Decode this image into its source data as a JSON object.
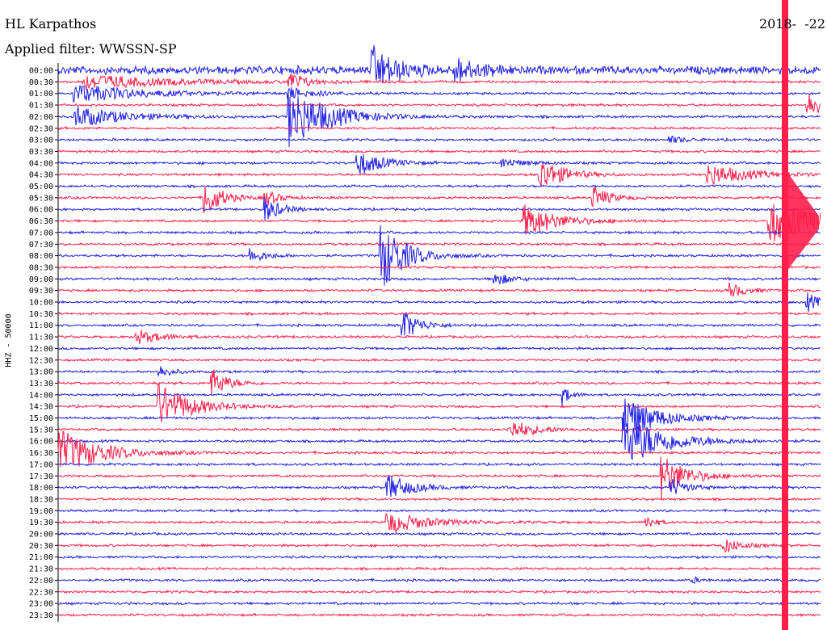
{
  "header": {
    "station": "HL Karpathos",
    "date": "2018-  -22",
    "filter": "Applied filter: WWSSN-SP"
  },
  "colors": {
    "even": "#1f1fe6",
    "odd": "#ff1f4b",
    "background": "#ffffff"
  },
  "chart_data": {
    "type": "line",
    "title": "HL Karpathos",
    "ylabel": "HHZ - 50000",
    "row_labels": [
      "00:00",
      "00:30",
      "01:00",
      "01:30",
      "02:00",
      "02:30",
      "03:00",
      "03:30",
      "04:00",
      "04:30",
      "05:00",
      "05:30",
      "06:00",
      "06:30",
      "07:00",
      "07:30",
      "08:00",
      "08:30",
      "09:00",
      "09:30",
      "10:00",
      "10:30",
      "11:00",
      "11:30",
      "12:00",
      "12:30",
      "13:00",
      "13:30",
      "14:00",
      "14:30",
      "15:00",
      "15:30",
      "16:00",
      "16:30",
      "17:00",
      "17:30",
      "18:00",
      "18:30",
      "19:00",
      "19:30",
      "20:00",
      "20:30",
      "21:00",
      "21:30",
      "22:00",
      "22:30",
      "23:00",
      "23:30"
    ],
    "events": [
      {
        "row": 0,
        "t": 0.41,
        "amp": 30,
        "dur": 0.03
      },
      {
        "row": 0,
        "t": 0.52,
        "amp": 16,
        "dur": 0.03
      },
      {
        "row": 1,
        "t": 0.03,
        "amp": 10,
        "dur": 0.1
      },
      {
        "row": 1,
        "t": 0.3,
        "amp": 14,
        "dur": 0.02
      },
      {
        "row": 2,
        "t": 0.02,
        "amp": 12,
        "dur": 0.08
      },
      {
        "row": 2,
        "t": 0.3,
        "amp": 8,
        "dur": 0.03
      },
      {
        "row": 3,
        "t": 0.98,
        "amp": 20,
        "dur": 0.02
      },
      {
        "row": 4,
        "t": 0.3,
        "amp": 40,
        "dur": 0.05
      },
      {
        "row": 4,
        "t": 0.02,
        "amp": 14,
        "dur": 0.06
      },
      {
        "row": 6,
        "t": 0.8,
        "amp": 5,
        "dur": 0.02
      },
      {
        "row": 8,
        "t": 0.39,
        "amp": 18,
        "dur": 0.03
      },
      {
        "row": 8,
        "t": 0.58,
        "amp": 6,
        "dur": 0.03
      },
      {
        "row": 9,
        "t": 0.63,
        "amp": 22,
        "dur": 0.03
      },
      {
        "row": 9,
        "t": 0.85,
        "amp": 14,
        "dur": 0.05
      },
      {
        "row": 11,
        "t": 0.19,
        "amp": 28,
        "dur": 0.02
      },
      {
        "row": 11,
        "t": 0.27,
        "amp": 12,
        "dur": 0.015
      },
      {
        "row": 11,
        "t": 0.7,
        "amp": 16,
        "dur": 0.02
      },
      {
        "row": 12,
        "t": 0.27,
        "amp": 16,
        "dur": 0.02
      },
      {
        "row": 13,
        "t": 0.61,
        "amp": 22,
        "dur": 0.04
      },
      {
        "row": 13,
        "t": 0.93,
        "amp": 30,
        "dur": 0.06
      },
      {
        "row": 16,
        "t": 0.42,
        "amp": 50,
        "dur": 0.03
      },
      {
        "row": 16,
        "t": 0.25,
        "amp": 10,
        "dur": 0.02
      },
      {
        "row": 18,
        "t": 0.57,
        "amp": 10,
        "dur": 0.02
      },
      {
        "row": 19,
        "t": 0.88,
        "amp": 10,
        "dur": 0.02
      },
      {
        "row": 20,
        "t": 0.98,
        "amp": 14,
        "dur": 0.015
      },
      {
        "row": 22,
        "t": 0.45,
        "amp": 22,
        "dur": 0.02
      },
      {
        "row": 23,
        "t": 0.1,
        "amp": 10,
        "dur": 0.03
      },
      {
        "row": 26,
        "t": 0.13,
        "amp": 10,
        "dur": 0.015
      },
      {
        "row": 27,
        "t": 0.2,
        "amp": 20,
        "dur": 0.02
      },
      {
        "row": 28,
        "t": 0.66,
        "amp": 14,
        "dur": 0.01
      },
      {
        "row": 29,
        "t": 0.13,
        "amp": 30,
        "dur": 0.04
      },
      {
        "row": 30,
        "t": 0.74,
        "amp": 30,
        "dur": 0.04
      },
      {
        "row": 31,
        "t": 0.59,
        "amp": 14,
        "dur": 0.03
      },
      {
        "row": 32,
        "t": 0.74,
        "amp": 36,
        "dur": 0.05
      },
      {
        "row": 33,
        "t": 0.0,
        "amp": 30,
        "dur": 0.05
      },
      {
        "row": 35,
        "t": 0.79,
        "amp": 30,
        "dur": 0.03
      },
      {
        "row": 36,
        "t": 0.43,
        "amp": 18,
        "dur": 0.03
      },
      {
        "row": 36,
        "t": 0.8,
        "amp": 14,
        "dur": 0.02
      },
      {
        "row": 39,
        "t": 0.43,
        "amp": 14,
        "dur": 0.05
      },
      {
        "row": 39,
        "t": 0.77,
        "amp": 12,
        "dur": 0.01
      },
      {
        "row": 41,
        "t": 0.87,
        "amp": 12,
        "dur": 0.02
      },
      {
        "row": 44,
        "t": 0.83,
        "amp": 5,
        "dur": 0.01
      }
    ]
  }
}
